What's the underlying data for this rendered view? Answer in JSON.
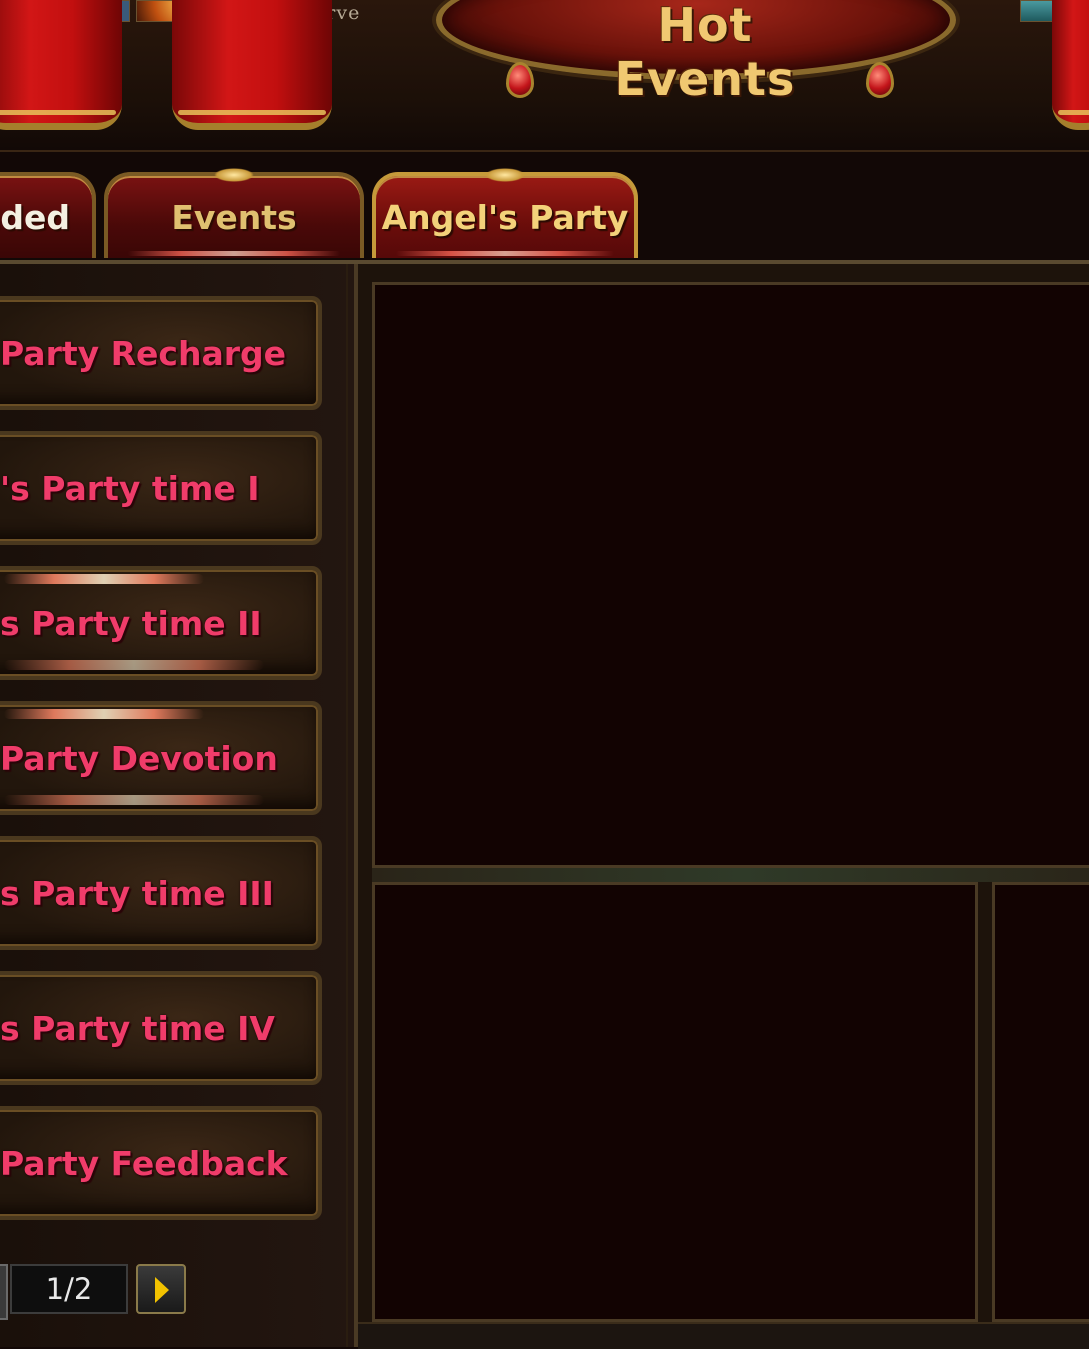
{
  "header": {
    "title": "Hot Events",
    "server_label": "X-serve"
  },
  "tabs": [
    {
      "label": "nded",
      "active": false
    },
    {
      "label": "Events",
      "active": false
    },
    {
      "label": "Angel's Party",
      "active": true
    }
  ],
  "event_list": [
    {
      "label": "Party Recharge"
    },
    {
      "label": "'s Party time I"
    },
    {
      "label": "s Party time II"
    },
    {
      "label": "Party Devotion"
    },
    {
      "label": "s Party time III"
    },
    {
      "label": "s Party time IV"
    },
    {
      "label": "Party Feedback"
    }
  ],
  "pager": {
    "text": "1/2"
  },
  "colors": {
    "event_text": "#f03c6a",
    "tab_text": "#e0c070",
    "title_text": "#f0c871",
    "curtain_red": "#d21616"
  },
  "icons": {
    "next_page": "arrow-right-icon"
  }
}
